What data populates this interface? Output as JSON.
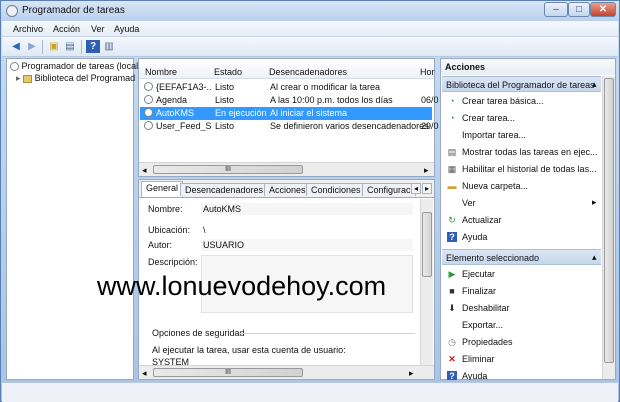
{
  "window": {
    "title": "Programador de tareas"
  },
  "menubar": {
    "archivo": "Archivo",
    "accion": "Acción",
    "ver": "Ver",
    "ayuda": "Ayuda"
  },
  "tree": {
    "root": "Programador de tareas (local",
    "child": "Biblioteca del Programad"
  },
  "tasks": {
    "columns": {
      "nombre": "Nombre",
      "estado": "Estado",
      "desencadenadores": "Desencadenadores",
      "hora": "Hor"
    },
    "rows": [
      {
        "nombre": "{EEFAF1A3-...",
        "estado": "Listo",
        "desencadenadores": "Al crear o modificar la tarea",
        "hora": ""
      },
      {
        "nombre": "Agenda",
        "estado": "Listo",
        "desencadenadores": "A las 10:00 p.m. todos los días",
        "hora": "06/0"
      },
      {
        "nombre": "AutoKMS",
        "estado": "En ejecución",
        "desencadenadores": "Al iniciar el sistema",
        "hora": ""
      },
      {
        "nombre": "User_Feed_S...",
        "estado": "Listo",
        "desencadenadores": "Se definieron varios desencadenadores",
        "hora": "29/0"
      }
    ],
    "scroll_mark": "III"
  },
  "details": {
    "tabs": [
      "General",
      "Desencadenadores",
      "Acciones",
      "Condiciones",
      "Configurac"
    ],
    "nombre_label": "Nombre:",
    "nombre_value": "AutoKMS",
    "ubicacion_label": "Ubicación:",
    "ubicacion_value": "\\",
    "autor_label": "Autor:",
    "autor_value": "USUARIO",
    "descripcion_label": "Descripción:",
    "seguridad_label": "Opciones de seguridad",
    "cuenta_text": "Al ejecutar la tarea, usar esta cuenta de usuario:",
    "cuenta_value": "SYSTEM",
    "scroll_mark": "III"
  },
  "actions": {
    "header": "Acciones",
    "section1": "Biblioteca del Programador de tareas",
    "items1": [
      {
        "label": "Crear tarea básica...",
        "icon": "create-basic-task-icon"
      },
      {
        "label": "Crear tarea...",
        "icon": "create-task-icon"
      },
      {
        "label": "Importar tarea...",
        "icon": ""
      },
      {
        "label": "Mostrar todas las tareas en ejec...",
        "icon": "running-tasks-icon"
      },
      {
        "label": "Habilitar el historial de todas las...",
        "icon": "history-icon"
      },
      {
        "label": "Nueva carpeta...",
        "icon": "folder-icon"
      },
      {
        "label": "Ver",
        "icon": ""
      },
      {
        "label": "Actualizar",
        "icon": "refresh-icon"
      },
      {
        "label": "Ayuda",
        "icon": "help-icon"
      }
    ],
    "section2": "Elemento seleccionado",
    "items2": [
      {
        "label": "Ejecutar",
        "icon": "run-icon"
      },
      {
        "label": "Finalizar",
        "icon": "stop-icon"
      },
      {
        "label": "Deshabilitar",
        "icon": "disable-icon"
      },
      {
        "label": "Exportar...",
        "icon": ""
      },
      {
        "label": "Propiedades",
        "icon": "properties-icon"
      },
      {
        "label": "Eliminar",
        "icon": "delete-icon"
      },
      {
        "label": "Ayuda",
        "icon": "help-icon"
      }
    ]
  },
  "watermark": "www.lonuevodehoy.com"
}
